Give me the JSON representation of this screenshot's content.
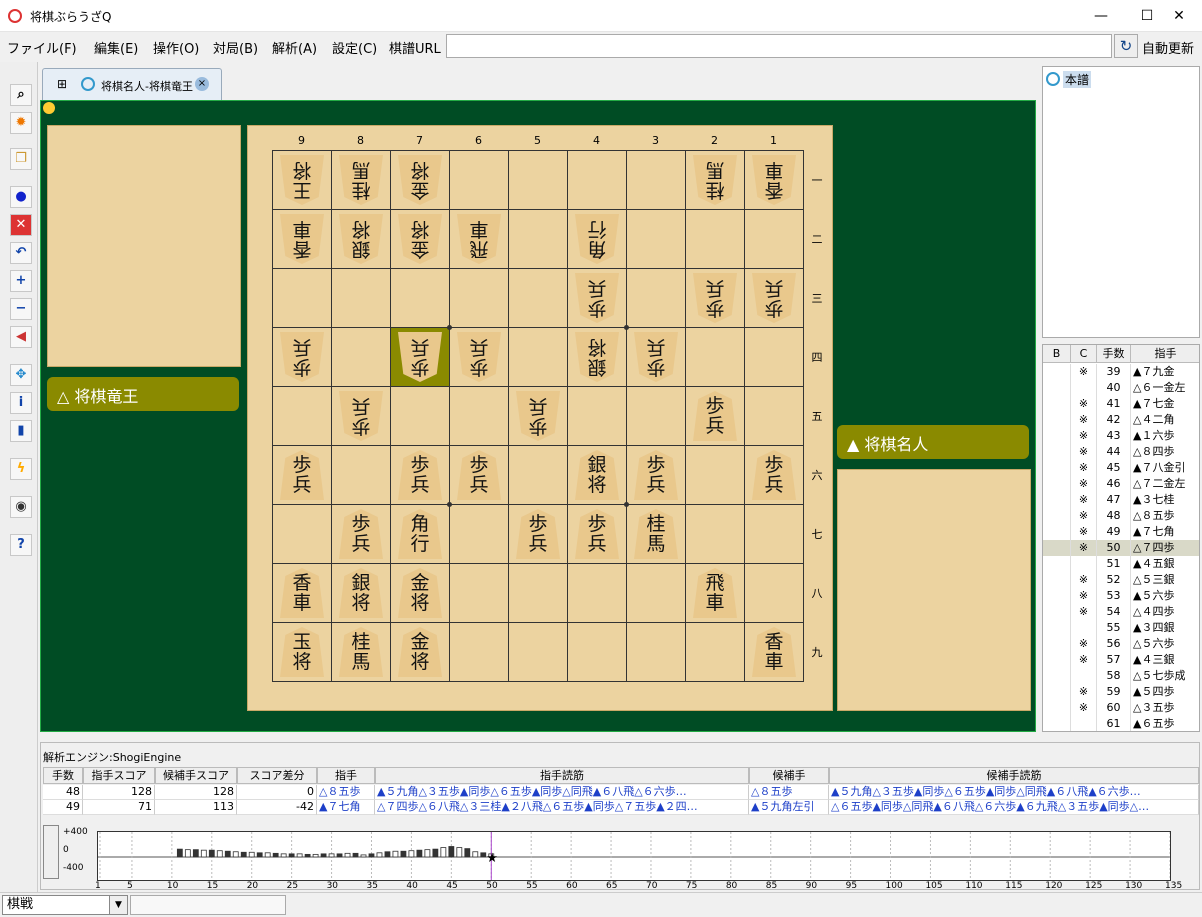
{
  "window": {
    "title": "将棋ぶらうざQ",
    "minimize": "—",
    "maximize": "☐",
    "close": "✕"
  },
  "menu": {
    "items": [
      "ファイル(F)",
      "編集(E)",
      "操作(O)",
      "対局(B)",
      "解析(A)",
      "設定(C)",
      "棋譜URL"
    ],
    "url_value": "",
    "refresh_icon": "refresh-icon",
    "auto_update": "自動更新"
  },
  "toolbar": {
    "icons": [
      "search-icon",
      "gear-icon",
      "copy-icon",
      "record-icon",
      "stop-red-icon",
      "undo-icon",
      "plus-icon",
      "minus-icon",
      "speaker-icon",
      "move-icon",
      "info-icon",
      "book-icon",
      "lightning-icon",
      "stop-icon",
      "help-icon"
    ]
  },
  "tab": {
    "label": "将棋名人-将棋竜王",
    "close": "×"
  },
  "players": {
    "gote": "△ 将棋竜王",
    "sente": "▲ 将棋名人"
  },
  "board": {
    "files": [
      "9",
      "8",
      "7",
      "6",
      "5",
      "4",
      "3",
      "2",
      "1"
    ],
    "ranks": [
      "一",
      "二",
      "三",
      "四",
      "五",
      "六",
      "七",
      "八",
      "九"
    ],
    "highlight": {
      "file": 7,
      "rank": 4
    },
    "pieces": [
      {
        "f": 9,
        "r": 1,
        "t": "王\n将",
        "s": "gote"
      },
      {
        "f": 8,
        "r": 1,
        "t": "桂\n馬",
        "s": "gote"
      },
      {
        "f": 7,
        "r": 1,
        "t": "金\n将",
        "s": "gote"
      },
      {
        "f": 2,
        "r": 1,
        "t": "桂\n馬",
        "s": "gote"
      },
      {
        "f": 1,
        "r": 1,
        "t": "香\n車",
        "s": "gote"
      },
      {
        "f": 9,
        "r": 2,
        "t": "香\n車",
        "s": "gote"
      },
      {
        "f": 8,
        "r": 2,
        "t": "銀\n将",
        "s": "gote"
      },
      {
        "f": 7,
        "r": 2,
        "t": "金\n将",
        "s": "gote"
      },
      {
        "f": 6,
        "r": 2,
        "t": "飛\n車",
        "s": "gote"
      },
      {
        "f": 4,
        "r": 2,
        "t": "角\n行",
        "s": "gote"
      },
      {
        "f": 4,
        "r": 3,
        "t": "歩\n兵",
        "s": "gote"
      },
      {
        "f": 2,
        "r": 3,
        "t": "歩\n兵",
        "s": "gote"
      },
      {
        "f": 1,
        "r": 3,
        "t": "歩\n兵",
        "s": "gote"
      },
      {
        "f": 9,
        "r": 4,
        "t": "歩\n兵",
        "s": "gote"
      },
      {
        "f": 7,
        "r": 4,
        "t": "歩\n兵",
        "s": "gote"
      },
      {
        "f": 6,
        "r": 4,
        "t": "歩\n兵",
        "s": "gote"
      },
      {
        "f": 4,
        "r": 4,
        "t": "銀\n将",
        "s": "gote"
      },
      {
        "f": 3,
        "r": 4,
        "t": "歩\n兵",
        "s": "gote"
      },
      {
        "f": 8,
        "r": 5,
        "t": "歩\n兵",
        "s": "gote"
      },
      {
        "f": 5,
        "r": 5,
        "t": "歩\n兵",
        "s": "gote"
      },
      {
        "f": 2,
        "r": 5,
        "t": "歩\n兵",
        "s": "sente"
      },
      {
        "f": 9,
        "r": 6,
        "t": "歩\n兵",
        "s": "sente"
      },
      {
        "f": 7,
        "r": 6,
        "t": "歩\n兵",
        "s": "sente"
      },
      {
        "f": 6,
        "r": 6,
        "t": "歩\n兵",
        "s": "sente"
      },
      {
        "f": 4,
        "r": 6,
        "t": "銀\n将",
        "s": "sente"
      },
      {
        "f": 3,
        "r": 6,
        "t": "歩\n兵",
        "s": "sente"
      },
      {
        "f": 1,
        "r": 6,
        "t": "歩\n兵",
        "s": "sente"
      },
      {
        "f": 8,
        "r": 7,
        "t": "歩\n兵",
        "s": "sente"
      },
      {
        "f": 7,
        "r": 7,
        "t": "角\n行",
        "s": "sente"
      },
      {
        "f": 5,
        "r": 7,
        "t": "歩\n兵",
        "s": "sente"
      },
      {
        "f": 4,
        "r": 7,
        "t": "歩\n兵",
        "s": "sente"
      },
      {
        "f": 3,
        "r": 7,
        "t": "桂\n馬",
        "s": "sente"
      },
      {
        "f": 9,
        "r": 8,
        "t": "香\n車",
        "s": "sente"
      },
      {
        "f": 8,
        "r": 8,
        "t": "銀\n将",
        "s": "sente"
      },
      {
        "f": 7,
        "r": 8,
        "t": "金\n将",
        "s": "sente"
      },
      {
        "f": 2,
        "r": 8,
        "t": "飛\n車",
        "s": "sente"
      },
      {
        "f": 9,
        "r": 9,
        "t": "玉\n将",
        "s": "sente"
      },
      {
        "f": 8,
        "r": 9,
        "t": "桂\n馬",
        "s": "sente"
      },
      {
        "f": 7,
        "r": 9,
        "t": "金\n将",
        "s": "sente"
      },
      {
        "f": 1,
        "r": 9,
        "t": "香\n車",
        "s": "sente"
      }
    ]
  },
  "tree": {
    "root": "本譜"
  },
  "kifu": {
    "headers": [
      "B",
      "C",
      "手数",
      "指手"
    ],
    "rows": [
      {
        "c": "※",
        "n": "39",
        "m": "▲７九金"
      },
      {
        "c": "",
        "n": "40",
        "m": "△６一金左"
      },
      {
        "c": "※",
        "n": "41",
        "m": "▲７七金"
      },
      {
        "c": "※",
        "n": "42",
        "m": "△４二角"
      },
      {
        "c": "※",
        "n": "43",
        "m": "▲１六歩"
      },
      {
        "c": "※",
        "n": "44",
        "m": "△８四歩"
      },
      {
        "c": "※",
        "n": "45",
        "m": "▲７八金引"
      },
      {
        "c": "※",
        "n": "46",
        "m": "△７二金左"
      },
      {
        "c": "※",
        "n": "47",
        "m": "▲３七桂"
      },
      {
        "c": "※",
        "n": "48",
        "m": "△８五歩"
      },
      {
        "c": "※",
        "n": "49",
        "m": "▲７七角"
      },
      {
        "c": "※",
        "n": "50",
        "m": "△７四歩"
      },
      {
        "c": "",
        "n": "51",
        "m": "▲４五銀"
      },
      {
        "c": "※",
        "n": "52",
        "m": "△５三銀"
      },
      {
        "c": "※",
        "n": "53",
        "m": "▲５六歩"
      },
      {
        "c": "※",
        "n": "54",
        "m": "△４四歩"
      },
      {
        "c": "",
        "n": "55",
        "m": "▲３四銀"
      },
      {
        "c": "※",
        "n": "56",
        "m": "△５六歩"
      },
      {
        "c": "※",
        "n": "57",
        "m": "▲４三銀"
      },
      {
        "c": "",
        "n": "58",
        "m": "△５七歩成"
      },
      {
        "c": "※",
        "n": "59",
        "m": "▲５四歩"
      },
      {
        "c": "※",
        "n": "60",
        "m": "△３五歩"
      },
      {
        "c": "",
        "n": "61",
        "m": "▲６五歩"
      }
    ],
    "selected": "50"
  },
  "analysis": {
    "engine": "解析エンジン:ShogiEngine",
    "headers": [
      "手数",
      "指手スコア",
      "候補手スコア",
      "スコア差分",
      "指手",
      "指手読筋",
      "候補手",
      "候補手読筋"
    ],
    "rows": [
      [
        "48",
        "128",
        "128",
        "0",
        "△８五歩",
        "▲５九角△３五歩▲同歩△６五歩▲同歩△同飛▲６八飛△６六歩…",
        "△８五歩",
        "▲５九角△３五歩▲同歩△６五歩▲同歩△同飛▲６八飛▲６六歩…"
      ],
      [
        "49",
        "71",
        "113",
        "-42",
        "▲７七角",
        "△７四歩△６八飛△３三桂▲２八飛△６五歩▲同歩△７五歩▲２四…",
        "▲５九角左引",
        "△６五歩▲同歩△同飛▲６八飛△６六歩▲６九飛△３五歩▲同歩△…"
      ]
    ]
  },
  "graph": {
    "y_labels": [
      "+400",
      "0",
      "-400"
    ],
    "x_labels": [
      "1",
      "5",
      "10",
      "15",
      "20",
      "25",
      "30",
      "35",
      "40",
      "45",
      "50",
      "55",
      "60",
      "65",
      "70",
      "75",
      "80",
      "85",
      "90",
      "95",
      "100",
      "105",
      "110",
      "115",
      "120",
      "125",
      "130",
      "135"
    ],
    "current_move": 50,
    "scores": [
      0,
      0,
      0,
      0,
      0,
      0,
      0,
      0,
      0,
      0,
      150,
      140,
      140,
      130,
      130,
      120,
      110,
      100,
      90,
      90,
      80,
      80,
      70,
      60,
      60,
      60,
      50,
      50,
      60,
      60,
      60,
      70,
      70,
      40,
      60,
      80,
      100,
      110,
      110,
      120,
      130,
      140,
      150,
      180,
      200,
      180,
      160,
      100,
      80,
      60
    ]
  },
  "status": {
    "mode": "棋戦",
    "field": ""
  }
}
